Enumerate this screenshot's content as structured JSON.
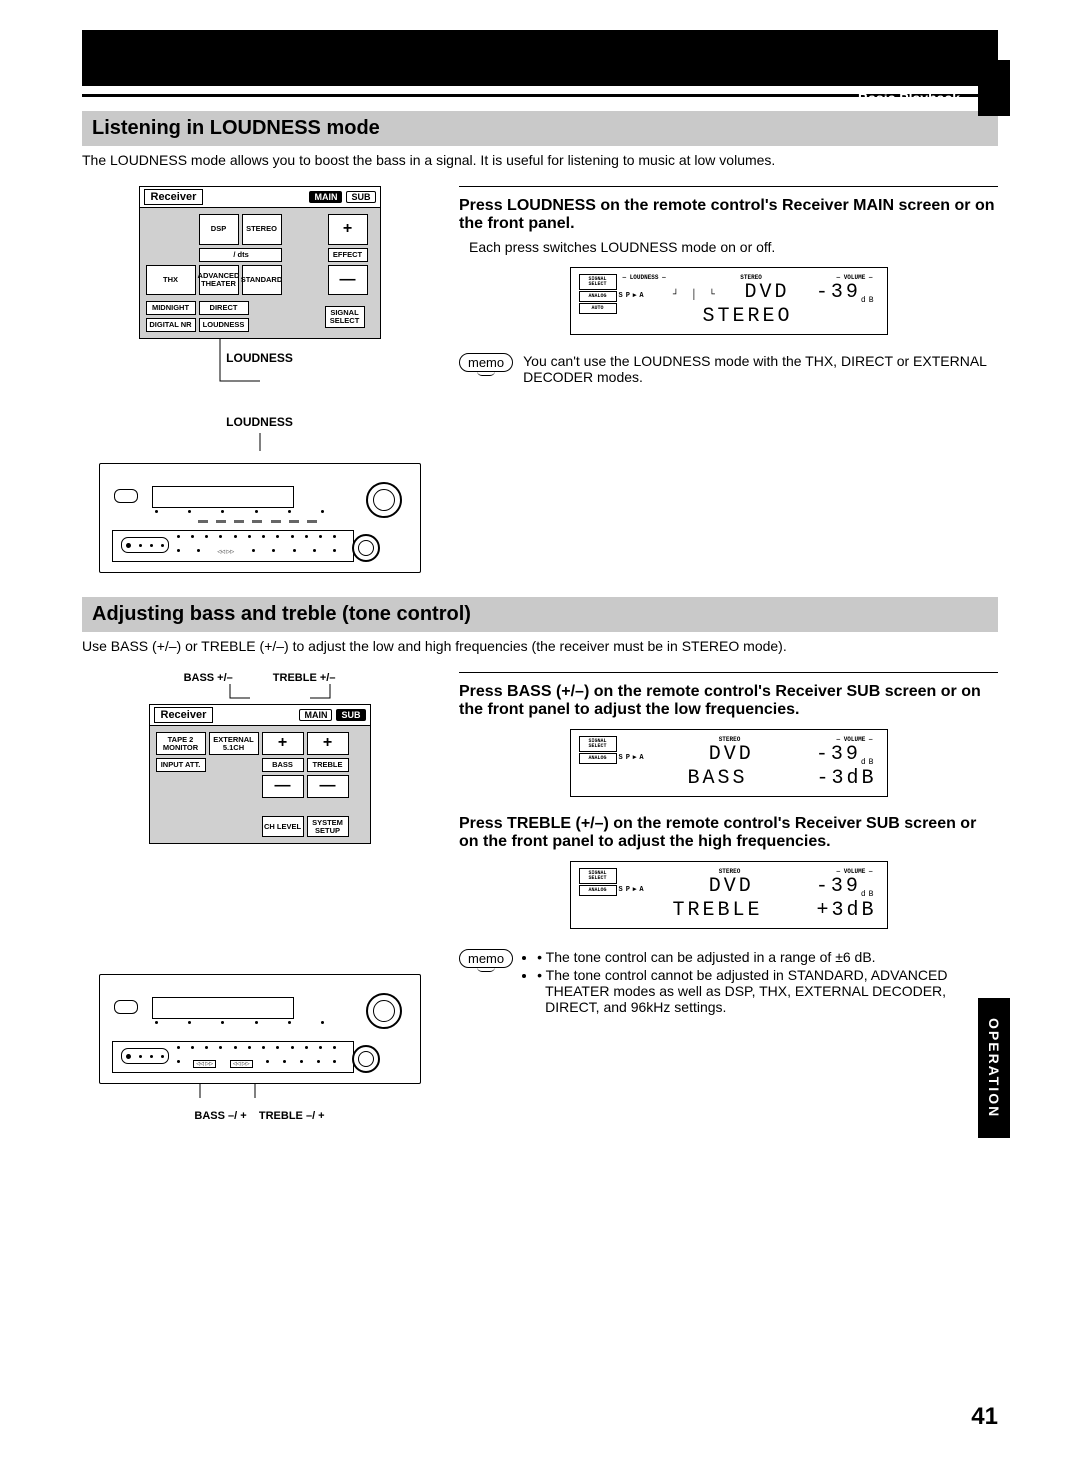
{
  "header": {
    "category": "Basic Playback"
  },
  "sidebar": {
    "tab": "OPERATION"
  },
  "pageNumber": "41",
  "section1": {
    "title": "Listening in LOUDNESS mode",
    "intro": "The LOUDNESS mode allows you to boost the bass in a signal. It is useful for listening to music at low volumes.",
    "remote": {
      "title": "Receiver",
      "tabs": {
        "main": "MAIN",
        "sub": "SUB"
      },
      "buttons": {
        "dsp": "DSP",
        "stereo": "STEREO",
        "dd_dts": " / dts",
        "effect": "EFFECT",
        "thx": "THX",
        "adv": "ADVANCED THEATER",
        "standard": "STANDARD",
        "midnight": "MIDNIGHT",
        "direct": "DIRECT",
        "digitalnr": "DIGITAL NR",
        "loudness": "LOUDNESS",
        "signal": "SIGNAL SELECT",
        "plus": "+",
        "minus": "—"
      }
    },
    "callout1": "LOUDNESS",
    "callout2": "LOUDNESS",
    "step": {
      "title": "Press LOUDNESS on the remote control's Receiver MAIN screen or on the front panel.",
      "sub": "Each press switches LOUDNESS mode on or off."
    },
    "display": {
      "sig": "SIGNAL SELECT",
      "ana": "ANALOG",
      "auto": "AUTO",
      "loudness": "LOUDNESS",
      "stereo_top": "STEREO",
      "vol": "VOLUME",
      "sp": "SP▸A",
      "src": "DVD",
      "volval": "-39",
      "db": "dB",
      "mode": "STEREO"
    },
    "memo": {
      "label": "memo",
      "text": "You can't use the LOUDNESS mode with the THX, DIRECT or EXTERNAL DECODER modes."
    }
  },
  "section2": {
    "title": "Adjusting bass and treble (tone control)",
    "intro": "Use BASS (+/–) or TREBLE (+/–) to adjust the low and high frequencies (the receiver must be in STEREO mode).",
    "labels": {
      "bass": "BASS +/–",
      "treble": "TREBLE +/–"
    },
    "remote": {
      "title": "Receiver",
      "tabs": {
        "main": "MAIN",
        "sub": "SUB"
      },
      "buttons": {
        "tape2": "TAPE 2 MONITOR",
        "ext51": "EXTERNAL 5.1CH",
        "input": "INPUT ATT.",
        "bass": "BASS",
        "treble": "TREBLE",
        "ch": "CH LEVEL",
        "sys": "SYSTEM SETUP",
        "plus": "+",
        "minus": "—"
      }
    },
    "step_bass": {
      "title": "Press BASS (+/–) on the remote control's Receiver SUB screen or on the front panel to adjust the low frequencies."
    },
    "display_bass": {
      "sig": "SIGNAL SELECT",
      "ana": "ANALOG",
      "stereo_top": "STEREO",
      "vol": "VOLUME",
      "sp": "SP▸A",
      "src": "DVD",
      "volval": "-39",
      "db": "dB",
      "param": "BASS",
      "paramval": "-3dB"
    },
    "step_treble": {
      "title": "Press TREBLE (+/–) on the remote control's Receiver SUB screen or on the front panel to adjust the high frequencies."
    },
    "display_treble": {
      "sig": "SIGNAL SELECT",
      "ana": "ANALOG",
      "stereo_top": "STEREO",
      "vol": "VOLUME",
      "sp": "SP▸A",
      "src": "DVD",
      "volval": "-39",
      "db": "dB",
      "param": "TREBLE",
      "paramval": "+3dB"
    },
    "panel_labels": {
      "bass": "BASS –/ +",
      "treble": "TREBLE –/ +"
    },
    "memo": {
      "label": "memo",
      "bullets": [
        "The tone control can be adjusted in a range of ±6 dB.",
        "The tone control cannot be adjusted in STANDARD, ADVANCED THEATER modes as well as DSP, THX, EXTERNAL DECODER, DIRECT, and 96kHz settings."
      ]
    }
  }
}
